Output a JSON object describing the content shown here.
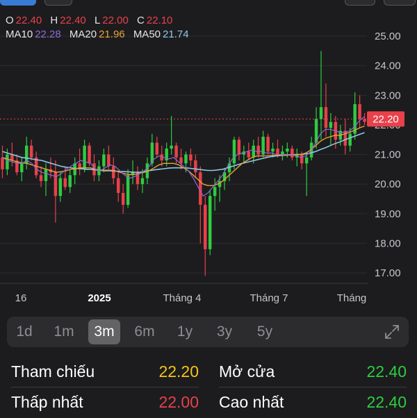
{
  "ohlc": {
    "o_label": "O",
    "o_value": "22.40",
    "h_label": "H",
    "h_value": "22.40",
    "l_label": "L",
    "l_value": "22.00",
    "c_label": "C",
    "c_value": "22.10"
  },
  "ma": {
    "ma10_label": "MA10",
    "ma10_value": "22.28",
    "ma20_label": "MA20",
    "ma20_value": "21.96",
    "ma50_label": "MA50",
    "ma50_value": "21.74"
  },
  "colors": {
    "up": "#2ecc40",
    "down": "#e8414b",
    "ma10": "#8e6bd8",
    "ma20": "#e8a23a",
    "ma50": "#8fc7e8",
    "current_price_tag": "#e8414b"
  },
  "chart_data": {
    "type": "candlestick",
    "y_ticks": [
      "25.00",
      "24.00",
      "23.00",
      "22.00",
      "21.00",
      "20.00",
      "19.00",
      "18.00",
      "17.00"
    ],
    "x_labels": [
      "16",
      "2025",
      "Tháng 4",
      "Tháng 7",
      "Tháng"
    ],
    "current_price": "22.20",
    "ylim": [
      17.0,
      25.0
    ],
    "candles": [
      {
        "o": 20.9,
        "h": 21.3,
        "l": 20.2,
        "c": 20.5
      },
      {
        "o": 20.5,
        "h": 21.2,
        "l": 20.3,
        "c": 21.0
      },
      {
        "o": 21.0,
        "h": 21.4,
        "l": 20.6,
        "c": 20.8
      },
      {
        "o": 20.8,
        "h": 21.0,
        "l": 20.3,
        "c": 20.4
      },
      {
        "o": 20.4,
        "h": 20.9,
        "l": 20.1,
        "c": 20.7
      },
      {
        "o": 20.7,
        "h": 21.6,
        "l": 20.5,
        "c": 21.3
      },
      {
        "o": 21.3,
        "h": 21.5,
        "l": 20.8,
        "c": 20.9
      },
      {
        "o": 20.9,
        "h": 21.1,
        "l": 20.2,
        "c": 20.3
      },
      {
        "o": 20.3,
        "h": 20.6,
        "l": 19.9,
        "c": 20.1
      },
      {
        "o": 20.1,
        "h": 20.7,
        "l": 19.6,
        "c": 20.5
      },
      {
        "o": 20.5,
        "h": 20.9,
        "l": 20.2,
        "c": 20.4
      },
      {
        "o": 20.4,
        "h": 20.8,
        "l": 18.7,
        "c": 19.6
      },
      {
        "o": 19.6,
        "h": 20.4,
        "l": 19.4,
        "c": 20.2
      },
      {
        "o": 20.2,
        "h": 20.6,
        "l": 19.8,
        "c": 19.9
      },
      {
        "o": 19.9,
        "h": 20.5,
        "l": 19.7,
        "c": 20.3
      },
      {
        "o": 20.3,
        "h": 20.9,
        "l": 20.0,
        "c": 20.7
      },
      {
        "o": 20.7,
        "h": 21.2,
        "l": 20.3,
        "c": 20.5
      },
      {
        "o": 20.5,
        "h": 21.5,
        "l": 20.4,
        "c": 21.3
      },
      {
        "o": 21.3,
        "h": 21.4,
        "l": 20.6,
        "c": 20.7
      },
      {
        "o": 20.7,
        "h": 21.0,
        "l": 20.1,
        "c": 20.3
      },
      {
        "o": 20.3,
        "h": 20.8,
        "l": 20.1,
        "c": 20.6
      },
      {
        "o": 20.6,
        "h": 21.2,
        "l": 20.4,
        "c": 21.0
      },
      {
        "o": 21.0,
        "h": 21.3,
        "l": 20.5,
        "c": 20.6
      },
      {
        "o": 20.6,
        "h": 20.9,
        "l": 20.0,
        "c": 20.2
      },
      {
        "o": 20.2,
        "h": 20.4,
        "l": 19.4,
        "c": 19.7
      },
      {
        "o": 19.7,
        "h": 20.0,
        "l": 19.0,
        "c": 19.3
      },
      {
        "o": 19.3,
        "h": 20.5,
        "l": 19.2,
        "c": 20.3
      },
      {
        "o": 20.3,
        "h": 20.8,
        "l": 20.0,
        "c": 20.4
      },
      {
        "o": 20.4,
        "h": 20.6,
        "l": 19.8,
        "c": 20.0
      },
      {
        "o": 20.0,
        "h": 20.5,
        "l": 19.7,
        "c": 20.2
      },
      {
        "o": 20.2,
        "h": 20.9,
        "l": 20.0,
        "c": 20.7
      },
      {
        "o": 20.7,
        "h": 21.7,
        "l": 20.6,
        "c": 21.4
      },
      {
        "o": 21.4,
        "h": 21.6,
        "l": 20.9,
        "c": 21.0
      },
      {
        "o": 21.0,
        "h": 21.3,
        "l": 20.6,
        "c": 20.8
      },
      {
        "o": 20.8,
        "h": 21.4,
        "l": 20.6,
        "c": 21.2
      },
      {
        "o": 21.2,
        "h": 22.3,
        "l": 21.0,
        "c": 21.3
      },
      {
        "o": 21.3,
        "h": 21.4,
        "l": 20.7,
        "c": 20.9
      },
      {
        "o": 20.9,
        "h": 21.2,
        "l": 20.5,
        "c": 20.7
      },
      {
        "o": 20.7,
        "h": 21.1,
        "l": 20.4,
        "c": 21.0
      },
      {
        "o": 21.0,
        "h": 21.2,
        "l": 20.6,
        "c": 20.8
      },
      {
        "o": 20.8,
        "h": 21.0,
        "l": 20.2,
        "c": 20.4
      },
      {
        "o": 20.4,
        "h": 20.6,
        "l": 18.0,
        "c": 19.3
      },
      {
        "o": 19.3,
        "h": 19.6,
        "l": 16.9,
        "c": 17.8
      },
      {
        "o": 17.8,
        "h": 19.8,
        "l": 17.6,
        "c": 19.6
      },
      {
        "o": 19.6,
        "h": 20.2,
        "l": 19.1,
        "c": 19.9
      },
      {
        "o": 19.9,
        "h": 20.3,
        "l": 19.4,
        "c": 20.1
      },
      {
        "o": 20.1,
        "h": 20.5,
        "l": 19.8,
        "c": 20.4
      },
      {
        "o": 20.4,
        "h": 20.9,
        "l": 20.1,
        "c": 20.7
      },
      {
        "o": 20.7,
        "h": 21.6,
        "l": 20.5,
        "c": 21.5
      },
      {
        "o": 21.5,
        "h": 21.6,
        "l": 20.8,
        "c": 21.0
      },
      {
        "o": 21.0,
        "h": 21.3,
        "l": 20.7,
        "c": 21.1
      },
      {
        "o": 21.1,
        "h": 21.4,
        "l": 20.8,
        "c": 20.9
      },
      {
        "o": 20.9,
        "h": 21.5,
        "l": 20.7,
        "c": 21.3
      },
      {
        "o": 21.3,
        "h": 21.6,
        "l": 20.9,
        "c": 21.0
      },
      {
        "o": 21.0,
        "h": 21.8,
        "l": 20.9,
        "c": 21.6
      },
      {
        "o": 21.6,
        "h": 21.7,
        "l": 21.0,
        "c": 21.1
      },
      {
        "o": 21.1,
        "h": 21.4,
        "l": 20.9,
        "c": 21.2
      },
      {
        "o": 21.2,
        "h": 21.5,
        "l": 20.9,
        "c": 21.0
      },
      {
        "o": 21.0,
        "h": 21.3,
        "l": 20.8,
        "c": 21.1
      },
      {
        "o": 21.1,
        "h": 21.4,
        "l": 20.9,
        "c": 21.2
      },
      {
        "o": 21.2,
        "h": 21.3,
        "l": 20.8,
        "c": 20.9
      },
      {
        "o": 20.9,
        "h": 21.2,
        "l": 20.6,
        "c": 21.0
      },
      {
        "o": 21.0,
        "h": 21.1,
        "l": 20.5,
        "c": 20.7
      },
      {
        "o": 20.7,
        "h": 21.0,
        "l": 19.6,
        "c": 20.9
      },
      {
        "o": 20.9,
        "h": 21.6,
        "l": 20.8,
        "c": 21.4
      },
      {
        "o": 21.4,
        "h": 22.6,
        "l": 21.2,
        "c": 22.2
      },
      {
        "o": 22.2,
        "h": 24.5,
        "l": 21.5,
        "c": 22.6
      },
      {
        "o": 22.6,
        "h": 23.4,
        "l": 21.6,
        "c": 21.9
      },
      {
        "o": 21.9,
        "h": 22.4,
        "l": 21.3,
        "c": 22.1
      },
      {
        "o": 22.1,
        "h": 22.3,
        "l": 21.2,
        "c": 21.5
      },
      {
        "o": 21.5,
        "h": 22.0,
        "l": 21.3,
        "c": 21.8
      },
      {
        "o": 21.8,
        "h": 22.2,
        "l": 21.0,
        "c": 21.3
      },
      {
        "o": 21.3,
        "h": 21.9,
        "l": 21.1,
        "c": 21.7
      },
      {
        "o": 21.7,
        "h": 23.1,
        "l": 21.5,
        "c": 22.7
      },
      {
        "o": 22.7,
        "h": 23.0,
        "l": 21.9,
        "c": 22.2
      },
      {
        "o": 22.2,
        "h": 22.4,
        "l": 22.0,
        "c": 22.1
      }
    ],
    "ma10": [
      20.9,
      20.8,
      20.75,
      20.7,
      20.7,
      20.8,
      20.7,
      20.5,
      20.4,
      20.35,
      20.3,
      20.25,
      20.35,
      20.5,
      20.6,
      20.7,
      20.8,
      20.75,
      20.7,
      20.5,
      20.45,
      20.55,
      20.65,
      20.6,
      20.45,
      20.3,
      20.2,
      20.25,
      20.35,
      20.45,
      20.6,
      20.85,
      20.95,
      20.9,
      20.85,
      20.9,
      20.75,
      20.6,
      20.45,
      20.2,
      19.9,
      19.6,
      19.7,
      19.9,
      20.1,
      20.3,
      20.6,
      20.85,
      21.0,
      21.05,
      21.1,
      21.15,
      21.1,
      21.1,
      21.05,
      21.05,
      21.0,
      21.0,
      21.0,
      21.0,
      20.95,
      20.9,
      20.95,
      21.1,
      21.4,
      21.7,
      21.85,
      21.85,
      21.8,
      21.75,
      21.75,
      21.8,
      21.95,
      22.15,
      22.28
    ],
    "ma20": [
      20.9,
      20.85,
      20.8,
      20.75,
      20.72,
      20.7,
      20.65,
      20.6,
      20.55,
      20.5,
      20.45,
      20.4,
      20.42,
      20.45,
      20.5,
      20.52,
      20.55,
      20.55,
      20.55,
      20.5,
      20.48,
      20.47,
      20.47,
      20.45,
      20.4,
      20.35,
      20.32,
      20.33,
      20.36,
      20.4,
      20.45,
      20.55,
      20.65,
      20.7,
      20.7,
      20.7,
      20.65,
      20.55,
      20.45,
      20.3,
      20.15,
      20.0,
      19.95,
      19.95,
      20.0,
      20.1,
      20.25,
      20.4,
      20.55,
      20.7,
      20.8,
      20.9,
      20.95,
      20.95,
      20.95,
      20.97,
      20.97,
      20.98,
      20.98,
      20.99,
      21.0,
      21.0,
      21.05,
      21.15,
      21.3,
      21.45,
      21.55,
      21.6,
      21.65,
      21.65,
      21.7,
      21.75,
      21.82,
      21.9,
      21.96
    ],
    "ma50": [
      21.1,
      21.05,
      21.0,
      20.95,
      20.9,
      20.88,
      20.85,
      20.82,
      20.8,
      20.75,
      20.7,
      20.65,
      20.6,
      20.57,
      20.55,
      20.53,
      20.52,
      20.5,
      20.5,
      20.48,
      20.46,
      20.45,
      20.45,
      20.44,
      20.43,
      20.42,
      20.41,
      20.4,
      20.4,
      20.42,
      20.45,
      20.48,
      20.5,
      20.52,
      20.54,
      20.55,
      20.55,
      20.55,
      20.54,
      20.52,
      20.5,
      20.48,
      20.46,
      20.46,
      20.48,
      20.5,
      20.55,
      20.6,
      20.65,
      20.7,
      20.74,
      20.78,
      20.82,
      20.86,
      20.9,
      20.93,
      20.95,
      20.97,
      20.98,
      20.99,
      21.0,
      21.0,
      21.02,
      21.05,
      21.1,
      21.17,
      21.23,
      21.3,
      21.37,
      21.43,
      21.5,
      21.56,
      21.62,
      21.68,
      21.74
    ]
  },
  "periods": [
    "1d",
    "1m",
    "3m",
    "6m",
    "1y",
    "3y",
    "5y"
  ],
  "active_period": "3m",
  "stats": {
    "ref_label": "Tham chiếu",
    "ref_value": "22.20",
    "open_label": "Mở cửa",
    "open_value": "22.40",
    "low_label": "Thấp nhất",
    "low_value": "22.00",
    "high_label": "Cao nhất",
    "high_value": "22.40"
  }
}
